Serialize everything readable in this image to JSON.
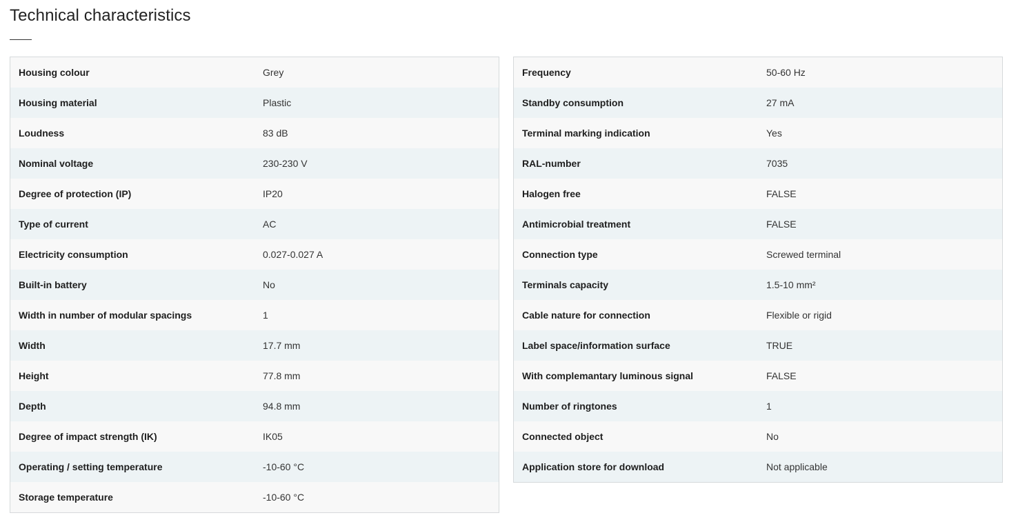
{
  "header": {
    "title": "Technical characteristics"
  },
  "left_table": {
    "rows": [
      {
        "label": "Housing colour",
        "value": "Grey"
      },
      {
        "label": "Housing material",
        "value": "Plastic"
      },
      {
        "label": "Loudness",
        "value": "83 dB"
      },
      {
        "label": "Nominal voltage",
        "value": "230-230 V"
      },
      {
        "label": "Degree of protection (IP)",
        "value": "IP20"
      },
      {
        "label": "Type of current",
        "value": "AC"
      },
      {
        "label": "Electricity consumption",
        "value": "0.027-0.027 A"
      },
      {
        "label": "Built-in battery",
        "value": "No"
      },
      {
        "label": "Width in number of modular spacings",
        "value": "1"
      },
      {
        "label": "Width",
        "value": "17.7 mm"
      },
      {
        "label": "Height",
        "value": "77.8 mm"
      },
      {
        "label": "Depth",
        "value": "94.8 mm"
      },
      {
        "label": "Degree of impact strength (IK)",
        "value": "IK05"
      },
      {
        "label": "Operating / setting temperature",
        "value": "-10-60 °C"
      },
      {
        "label": "Storage temperature",
        "value": "-10-60 °C"
      }
    ]
  },
  "right_table": {
    "rows": [
      {
        "label": "Frequency",
        "value": "50-60 Hz"
      },
      {
        "label": "Standby consumption",
        "value": "27 mA"
      },
      {
        "label": "Terminal marking indication",
        "value": "Yes"
      },
      {
        "label": "RAL-number",
        "value": "7035"
      },
      {
        "label": "Halogen free",
        "value": "FALSE"
      },
      {
        "label": "Antimicrobial treatment",
        "value": "FALSE"
      },
      {
        "label": "Connection type",
        "value": "Screwed terminal"
      },
      {
        "label": "Terminals capacity",
        "value": "1.5-10 mm²"
      },
      {
        "label": "Cable nature for connection",
        "value": "Flexible or rigid"
      },
      {
        "label": "Label space/information surface",
        "value": "TRUE"
      },
      {
        "label": "With complemantary luminous signal",
        "value": "FALSE"
      },
      {
        "label": "Number of ringtones",
        "value": "1"
      },
      {
        "label": "Connected object",
        "value": "No"
      },
      {
        "label": "Application store for download",
        "value": "Not applicable"
      }
    ]
  }
}
